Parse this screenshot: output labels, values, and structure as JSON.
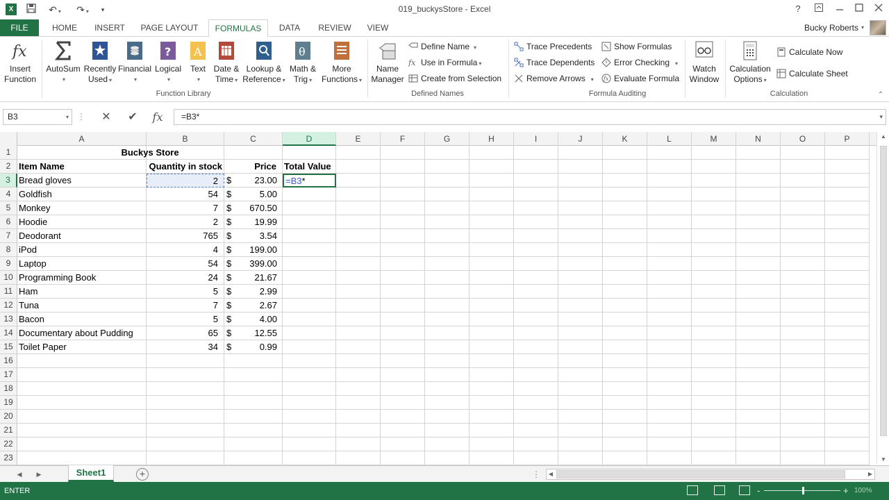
{
  "window": {
    "title": "019_buckysStore - Excel",
    "app_logo": "X",
    "help": "?",
    "qat": {
      "undo_caret": "▾",
      "redo_caret": "▾",
      "customize": "▾"
    }
  },
  "tabs": {
    "file": "FILE",
    "items": [
      "HOME",
      "INSERT",
      "PAGE LAYOUT",
      "FORMULAS",
      "DATA",
      "REVIEW",
      "VIEW"
    ],
    "active": "FORMULAS",
    "user": "Bucky Roberts"
  },
  "ribbon": {
    "function_library": {
      "label": "Function Library",
      "insert_function": [
        "Insert",
        "Function"
      ],
      "autosum": "AutoSum",
      "recently_used": [
        "Recently",
        "Used"
      ],
      "financial": "Financial",
      "logical": "Logical",
      "text": "Text",
      "date_time": [
        "Date &",
        "Time"
      ],
      "lookup": [
        "Lookup &",
        "Reference"
      ],
      "math": [
        "Math &",
        "Trig"
      ],
      "more": [
        "More",
        "Functions"
      ]
    },
    "defined_names": {
      "label": "Defined Names",
      "name_manager": [
        "Name",
        "Manager"
      ],
      "define_name": "Define Name",
      "use_in_formula": "Use in Formula",
      "create_from_selection": "Create from Selection"
    },
    "formula_auditing": {
      "label": "Formula Auditing",
      "trace_precedents": "Trace Precedents",
      "trace_dependents": "Trace Dependents",
      "remove_arrows": "Remove Arrows",
      "show_formulas": "Show Formulas",
      "error_checking": "Error Checking",
      "evaluate_formula": "Evaluate Formula",
      "watch_window": [
        "Watch",
        "Window"
      ]
    },
    "calculation": {
      "label": "Calculation",
      "calculation_options": [
        "Calculation",
        "Options"
      ],
      "calculate_now": "Calculate Now",
      "calculate_sheet": "Calculate Sheet"
    },
    "colors": {
      "accent": "#217346",
      "reference": "#3c5ec4"
    }
  },
  "formula_bar": {
    "name_box": "B3",
    "cancel_glyph": "✕",
    "enter_glyph": "✔",
    "fx_glyph": "fx",
    "formula": "=B3*"
  },
  "sheet": {
    "columns": [
      "A",
      "B",
      "C",
      "D",
      "E",
      "F",
      "G",
      "H",
      "I",
      "J",
      "K",
      "L",
      "M",
      "N",
      "O",
      "P"
    ],
    "rows": [
      "1",
      "2",
      "3",
      "4",
      "5",
      "6",
      "7",
      "8",
      "9",
      "10",
      "11",
      "12",
      "13",
      "14",
      "15",
      "16",
      "17",
      "18",
      "19",
      "20",
      "21",
      "22",
      "23"
    ],
    "title": "Buckys Store",
    "headers": [
      "Item Name",
      "Quantity in stock",
      "Price",
      "Total Value"
    ],
    "currency": "$",
    "items": [
      {
        "name": "Bread gloves",
        "qty": "2",
        "price": "23.00"
      },
      {
        "name": "Goldfish",
        "qty": "54",
        "price": "5.00"
      },
      {
        "name": "Monkey",
        "qty": "7",
        "price": "670.50"
      },
      {
        "name": "Hoodie",
        "qty": "2",
        "price": "19.99"
      },
      {
        "name": "Deodorant",
        "qty": "765",
        "price": "3.54"
      },
      {
        "name": "iPod",
        "qty": "4",
        "price": "199.00"
      },
      {
        "name": "Laptop",
        "qty": "54",
        "price": "399.00"
      },
      {
        "name": "Programming Book",
        "qty": "24",
        "price": "21.67"
      },
      {
        "name": "Ham",
        "qty": "5",
        "price": "2.99"
      },
      {
        "name": "Tuna",
        "qty": "7",
        "price": "2.67"
      },
      {
        "name": "Bacon",
        "qty": "5",
        "price": "4.00"
      },
      {
        "name": "Documentary about Pudding",
        "qty": "65",
        "price": "12.55"
      },
      {
        "name": "Toilet Paper",
        "qty": "34",
        "price": "0.99"
      }
    ],
    "editing_cell_ref": "=B3",
    "editing_cell_op": "*"
  },
  "sheet_tabs": {
    "active": "Sheet1",
    "add": "+",
    "overflow": "⋮"
  },
  "status": {
    "mode": "ENTER",
    "zoom_minus": "-",
    "zoom_plus": "+",
    "zoom": "100%"
  }
}
